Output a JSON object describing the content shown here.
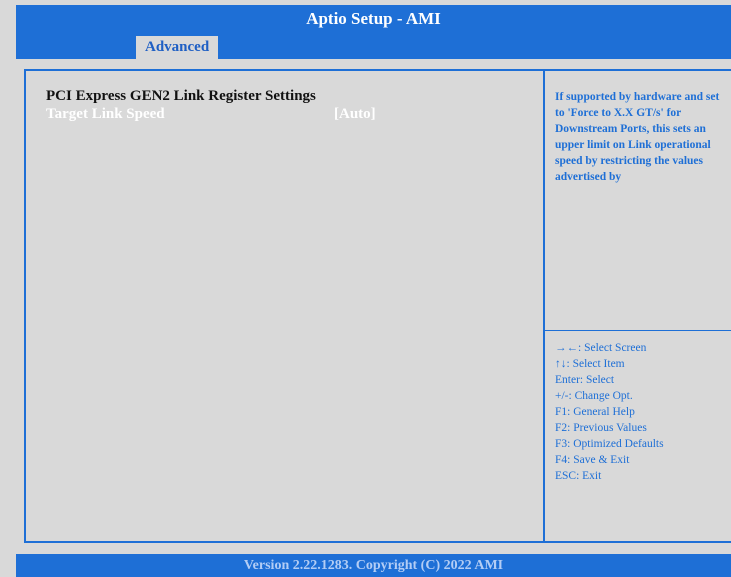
{
  "header": {
    "title": "Aptio Setup - AMI"
  },
  "tabs": [
    {
      "label": "Advanced",
      "active": true
    }
  ],
  "main": {
    "section_heading": "PCI Express GEN2 Link Register Settings",
    "settings": [
      {
        "label": "Target Link Speed",
        "value": "[Auto]"
      }
    ]
  },
  "help": {
    "text": "If supported by hardware and set to 'Force to X.X GT/s' for Downstream Ports, this sets an upper limit on Link operational speed by restricting the values advertised by"
  },
  "keys": [
    "→←: Select Screen",
    "↑↓: Select Item",
    "Enter: Select",
    "+/-: Change Opt.",
    "F1: General Help",
    "F2: Previous Values",
    "F3: Optimized Defaults",
    "F4: Save & Exit",
    "ESC: Exit"
  ],
  "footer": {
    "version": "Version 2.22.1283. Copyright (C) 2022 AMI"
  },
  "colors": {
    "accent": "#1e6fd6",
    "background": "#d9d9d9",
    "selected_text": "#ffffff",
    "footer_text": "#b3cdf5"
  }
}
